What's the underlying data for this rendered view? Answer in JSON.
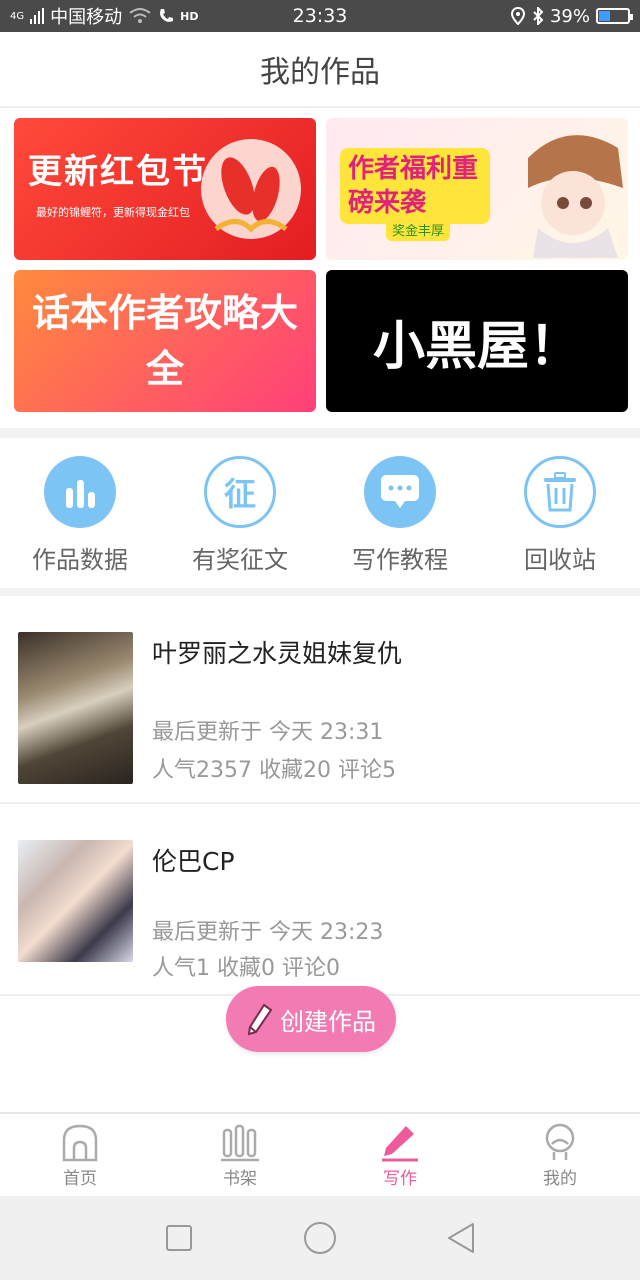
{
  "status_bar": {
    "network": "4G",
    "carrier": "中国移动",
    "hd": "HD",
    "time": "23:33",
    "battery": "39%",
    "battery_level": 0.39
  },
  "header": {
    "title": "我的作品"
  },
  "banners": [
    {
      "title": "更新红包节",
      "subtitle": "最好的锦鲤符，更新得现金红包"
    },
    {
      "title": "作者福利重磅来袭",
      "subtitle": "奖金丰厚"
    },
    {
      "title": "话本作者攻略大全"
    },
    {
      "title": "小黑屋！"
    }
  ],
  "tools": [
    {
      "label": "作品数据",
      "icon": "bar-chart-icon"
    },
    {
      "label": "有奖征文",
      "icon": "contest-icon",
      "glyph": "征"
    },
    {
      "label": "写作教程",
      "icon": "chat-bubble-icon"
    },
    {
      "label": "回收站",
      "icon": "trash-icon"
    }
  ],
  "works": [
    {
      "title": "叶罗丽之水灵姐妹复仇",
      "updated": "最后更新于 今天 23:31",
      "stats": "人气2357 收藏20 评论5"
    },
    {
      "title": "伦巴CP",
      "updated": "最后更新于 今天 23:23",
      "stats": "人气1 收藏0 评论0"
    }
  ],
  "create_button": {
    "label": "创建作品"
  },
  "tabbar": [
    {
      "label": "首页",
      "icon": "home-icon"
    },
    {
      "label": "书架",
      "icon": "bookshelf-icon"
    },
    {
      "label": "写作",
      "icon": "pencil-icon",
      "active": true
    },
    {
      "label": "我的",
      "icon": "profile-icon"
    }
  ],
  "colors": {
    "accent_pink": "#ee5a9a",
    "icon_blue": "#7cc4f4",
    "status_bar_bg": "#4a4a4a"
  }
}
